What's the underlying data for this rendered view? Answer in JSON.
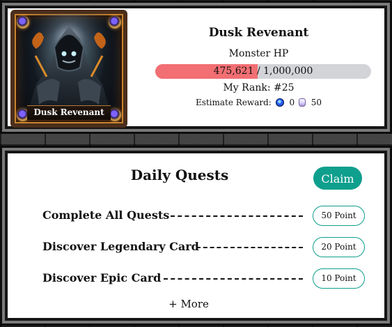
{
  "boss": {
    "card_name": "Dusk Revenant",
    "name": "Dusk Revenant",
    "hp_label": "Monster HP",
    "hp_current": "475,621",
    "hp_separator": "/",
    "hp_max": "1,000,000",
    "hp_fraction": 0.475621,
    "rank_text": "My Rank: #25",
    "reward_label": "Estimate Reward:",
    "reward_token_icon": "token-icon",
    "reward_token_amount": "0",
    "reward_skull_icon": "skull-icon",
    "reward_skull_amount": "50"
  },
  "quests": {
    "title": "Daily Quests",
    "claim_label": "Claim",
    "items": [
      {
        "name": "Complete All Quests",
        "points": "50 Point"
      },
      {
        "name": "Discover Legendary Card",
        "points": "20 Point"
      },
      {
        "name": "Discover Epic Card",
        "points": "10 Point"
      }
    ],
    "more_label": "+ More"
  },
  "colors": {
    "hp_fill": "#f26f73",
    "hp_track": "#d3d4d8",
    "accent": "#0f9f8d"
  }
}
